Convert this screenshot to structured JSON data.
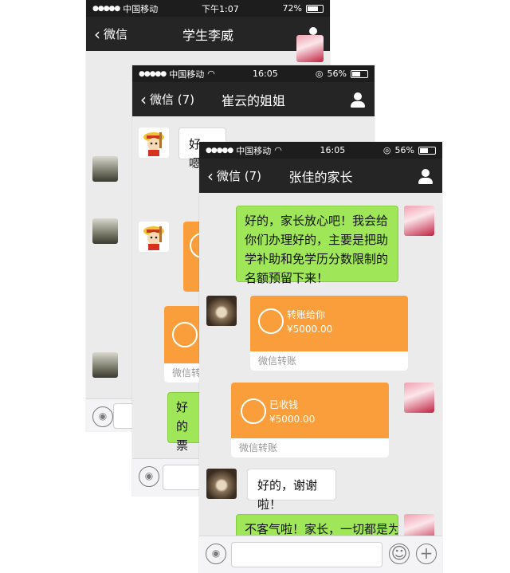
{
  "phone1": {
    "status": {
      "carrier": "中国移动",
      "time": "下午1:07",
      "battery": "72%"
    },
    "nav": {
      "back": "微信",
      "title": "学生李威"
    }
  },
  "phone2": {
    "status": {
      "carrier": "中国移动",
      "time": "16:05",
      "battery": "56%"
    },
    "nav": {
      "back": "微信 (7)",
      "title": "崔云的姐姐"
    },
    "messages": {
      "reply": "好嗯！",
      "card_footer": "微信转账",
      "partial1": "好的",
      "partial2": "票好"
    }
  },
  "phone3": {
    "status": {
      "carrier": "中国移动",
      "time": "16:05",
      "battery": "56%"
    },
    "nav": {
      "back": "微信 (7)",
      "title": "张佳的家长"
    },
    "messages": {
      "m1": "好的，家长放心吧！我会给你们办理好的，主要是把助学补助和免学历分数限制的名额预留下来！",
      "transfer1": {
        "title": "转账给你",
        "amount": "¥5000.00",
        "footer": "微信转账"
      },
      "transfer2": {
        "title": "已收钱",
        "amount": "¥5000.00",
        "footer": "微信转账"
      },
      "m2": "好的，谢谢啦！",
      "m3": "不客气啦！家长，一切都是为"
    }
  }
}
